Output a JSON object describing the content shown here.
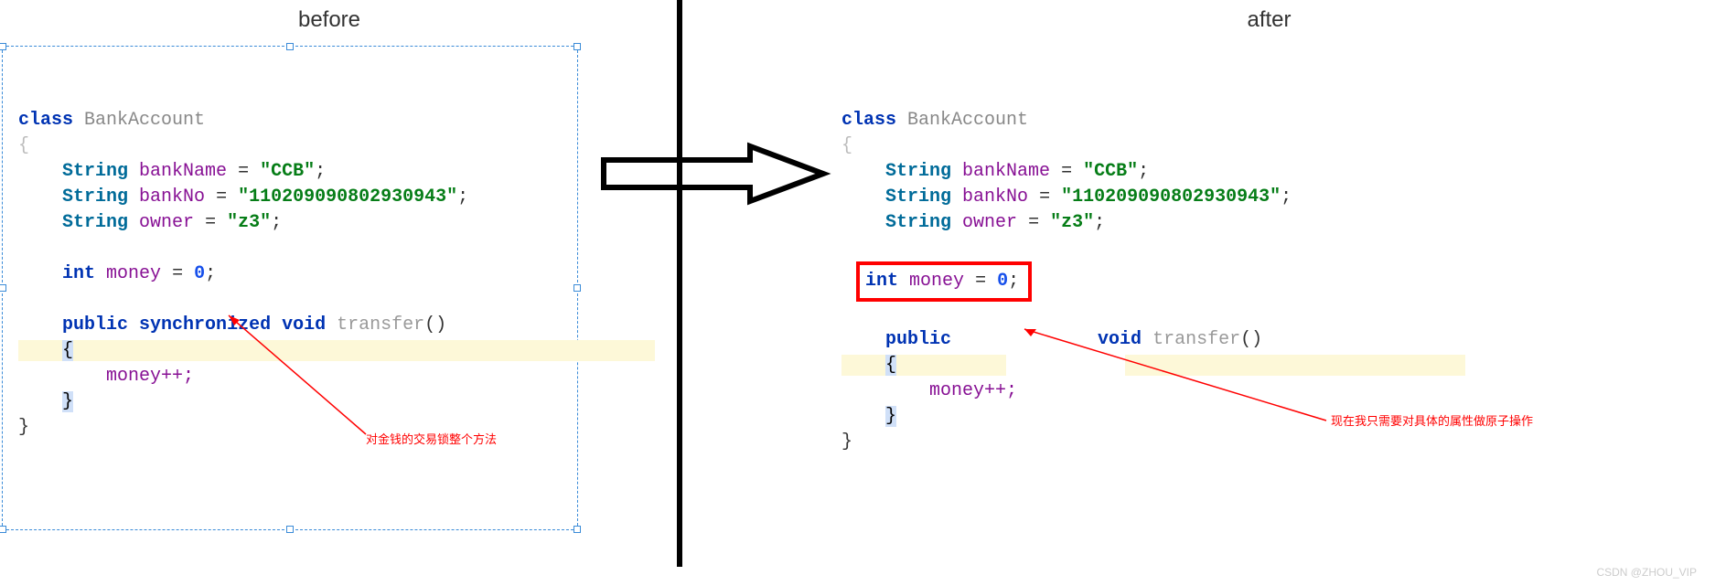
{
  "heading_left": "before",
  "heading_right": "after",
  "watermark": "CSDN @ZHOU_VIP",
  "left_annotation": "对金钱的交易锁整个方法",
  "right_annotation": "现在我只需要对具体的属性做原子操作",
  "code_tokens": {
    "class_kw": "class",
    "class_name": "BankAccount",
    "String": "String",
    "bankName": "bankName",
    "bankNo": "bankNo",
    "owner": "owner",
    "eq": " = ",
    "ccb": "\"CCB\"",
    "bankno_val": "\"110209090802930943\"",
    "z3": "\"z3\"",
    "int": "int",
    "money": "money",
    "zero": "0",
    "public": "public",
    "synchronized": "synchronized",
    "void": "void",
    "transfer": "transfer",
    "inc": "money++;",
    "brace_open": "{",
    "brace_close": "}",
    "paren": "()",
    "semi": ";"
  }
}
